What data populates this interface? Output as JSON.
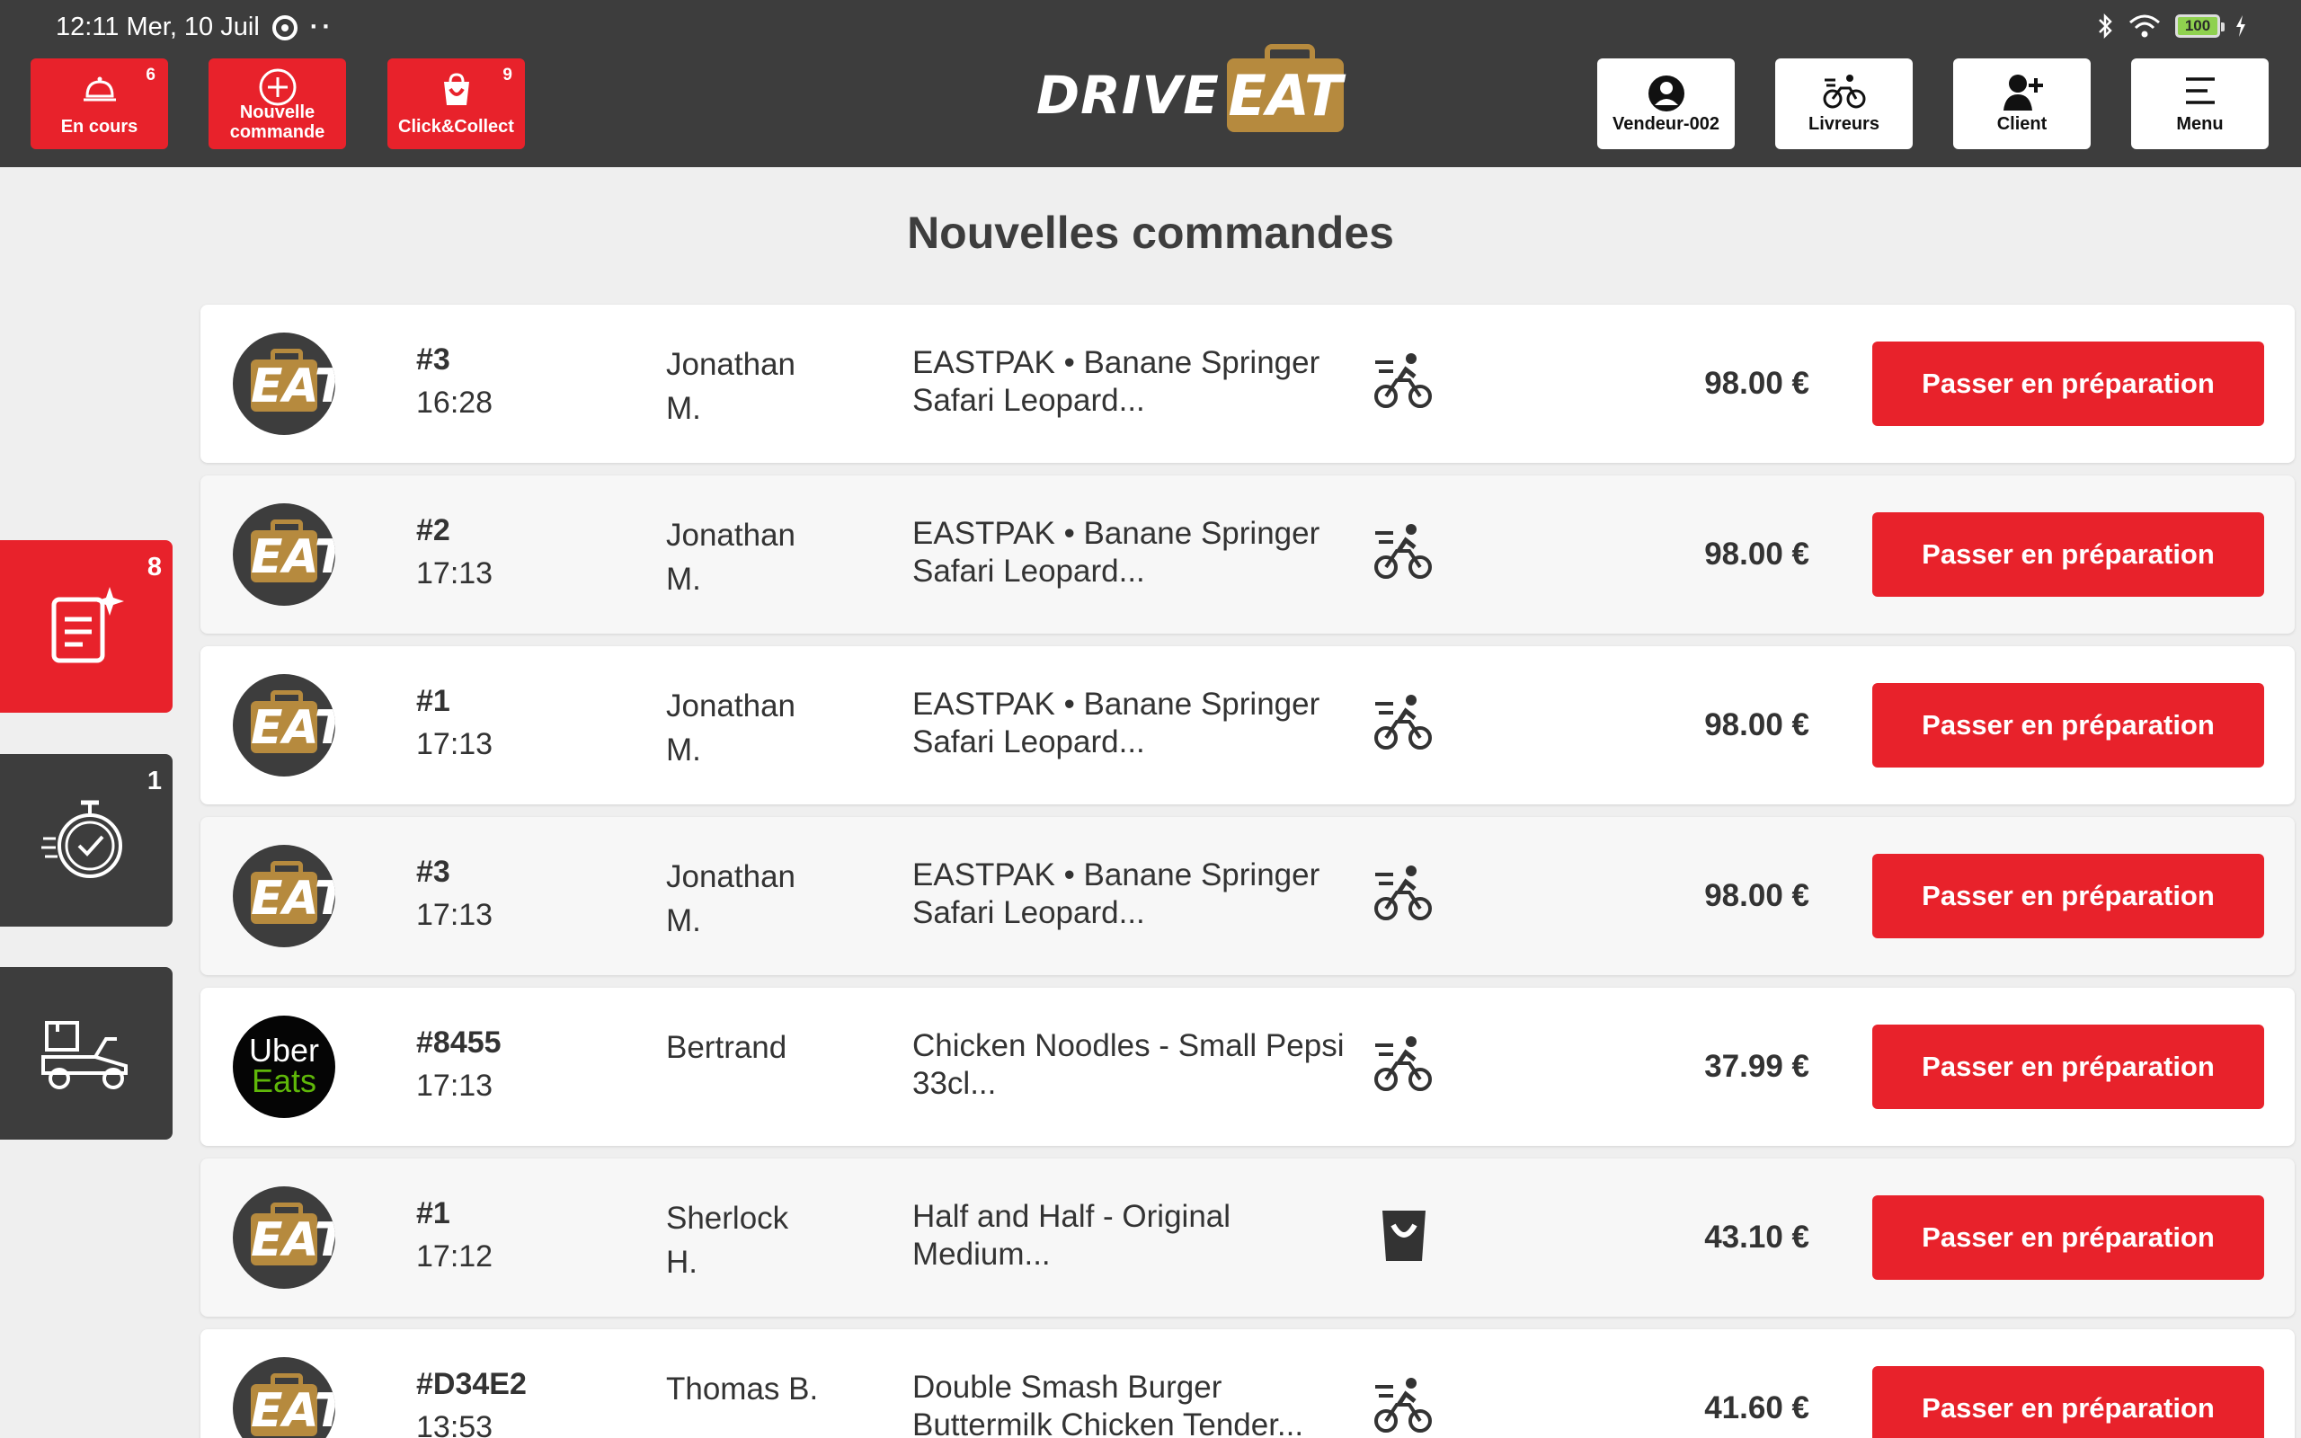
{
  "statusbar": {
    "time_date": "12:11 Mer, 10 Juil",
    "battery": "100"
  },
  "header": {
    "left_buttons": [
      {
        "label": "En cours",
        "badge": "6",
        "icon": "cloche-icon"
      },
      {
        "label": "Nouvelle commande",
        "badge": "",
        "icon": "plus-circle-icon"
      },
      {
        "label": "Click&Collect",
        "badge": "9",
        "icon": "shopping-bag-icon"
      }
    ],
    "logo": {
      "drive": "DRIVE",
      "eat": "EAT"
    },
    "right_buttons": [
      {
        "label": "Vendeur-002",
        "icon": "user-icon"
      },
      {
        "label": "Livreurs",
        "icon": "bicycle-icon"
      },
      {
        "label": "Client",
        "icon": "add-user-icon"
      },
      {
        "label": "Menu",
        "icon": "menu-icon"
      }
    ]
  },
  "sidebar": {
    "tabs": [
      {
        "badge": "8",
        "icon": "new-orders-icon",
        "active": true
      },
      {
        "badge": "1",
        "icon": "stopwatch-icon",
        "active": false
      },
      {
        "badge": "",
        "icon": "delivery-scooter-icon",
        "active": false
      }
    ]
  },
  "main": {
    "title": "Nouvelles commandes",
    "orders": [
      {
        "source": "drive-eat",
        "number": "#3",
        "time": "16:28",
        "customer": "Jonathan M.",
        "items": "EASTPAK • Banane Springer Safari Leopard...",
        "mode": "delivery",
        "price": "98.00 €",
        "action": "Passer en préparation"
      },
      {
        "source": "drive-eat",
        "number": "#2",
        "time": "17:13",
        "customer": "Jonathan M.",
        "items": "EASTPAK • Banane Springer Safari Leopard...",
        "mode": "delivery",
        "price": "98.00 €",
        "action": "Passer en préparation"
      },
      {
        "source": "drive-eat",
        "number": "#1",
        "time": "17:13",
        "customer": "Jonathan M.",
        "items": "EASTPAK • Banane Springer Safari Leopard...",
        "mode": "delivery",
        "price": "98.00 €",
        "action": "Passer en préparation"
      },
      {
        "source": "drive-eat",
        "number": "#3",
        "time": "17:13",
        "customer": "Jonathan M.",
        "items": "EASTPAK • Banane Springer Safari Leopard...",
        "mode": "delivery",
        "price": "98.00 €",
        "action": "Passer en préparation"
      },
      {
        "source": "uber-eats",
        "number": "#8455",
        "time": "17:13",
        "customer": "Bertrand",
        "items": "Chicken Noodles - Small Pepsi 33cl...",
        "mode": "delivery",
        "price": "37.99 €",
        "action": "Passer en préparation"
      },
      {
        "source": "drive-eat",
        "number": "#1",
        "time": "17:12",
        "customer": "Sherlock H.",
        "items": "Half and Half - Original Medium...",
        "mode": "click-collect",
        "price": "43.10 €",
        "action": "Passer en préparation"
      },
      {
        "source": "drive-eat",
        "number": "#D34E2",
        "time": "13:53",
        "customer": "Thomas B.",
        "items": "Double Smash Burger Buttermilk Chicken Tender...",
        "mode": "delivery",
        "price": "41.60 €",
        "action": "Passer en préparation"
      }
    ],
    "uber_logo": {
      "line1": "Uber",
      "line2": "Eats"
    }
  },
  "colors": {
    "header_bg": "#3d3d3d",
    "accent_red": "#e8222b",
    "brand_gold": "#b68a3e",
    "uber_green": "#5fb709"
  }
}
